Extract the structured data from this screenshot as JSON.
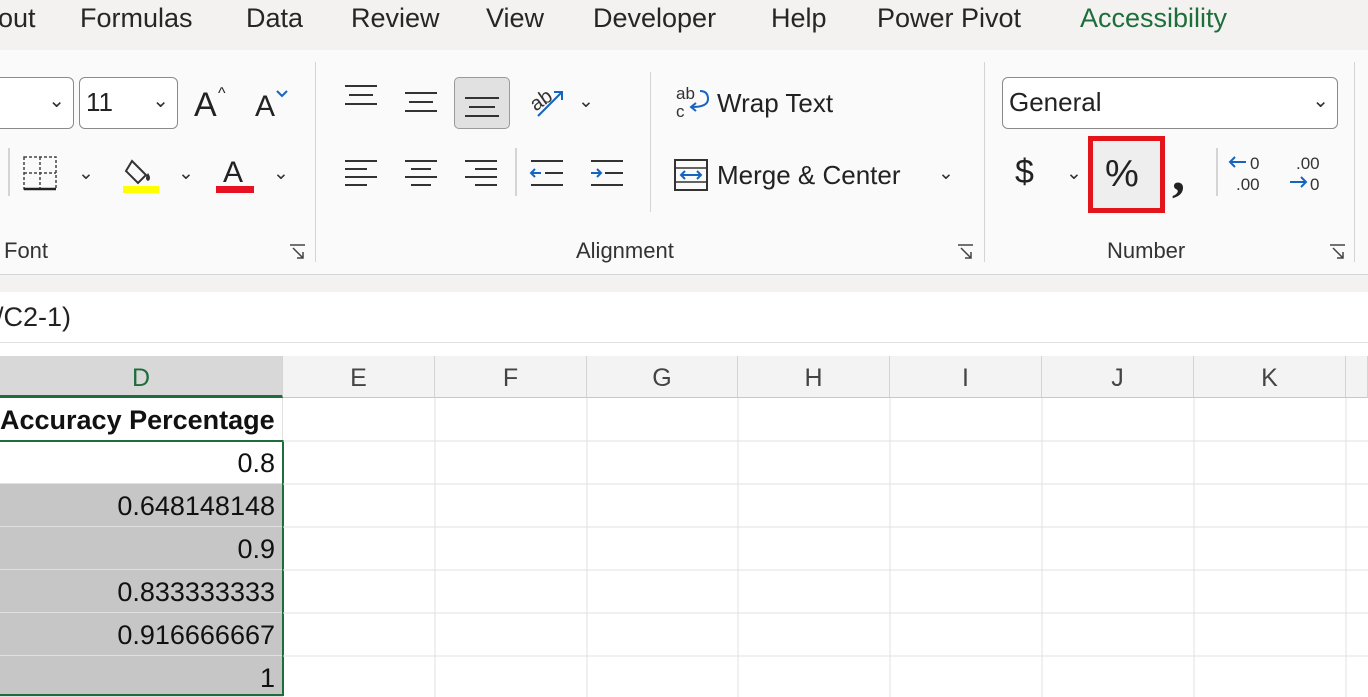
{
  "tabs": [
    "out",
    "Formulas",
    "Data",
    "Review",
    "View",
    "Developer",
    "Help",
    "Power Pivot",
    "Accessibility"
  ],
  "font_group": {
    "label": "Font",
    "font_size": "11"
  },
  "alignment_group": {
    "label": "Alignment",
    "wrap_text": "Wrap Text",
    "merge_center": "Merge & Center"
  },
  "number_group": {
    "label": "Number",
    "format": "General",
    "currency_symbol": "$",
    "percent_symbol": "%",
    "comma_symbol": ","
  },
  "formula_bar": {
    "text": "/C2-1)"
  },
  "columns": [
    "D",
    "E",
    "F",
    "G",
    "H",
    "I",
    "J",
    "K"
  ],
  "column_d": {
    "header": "Accuracy Percentage",
    "values": [
      "0.8",
      "0.648148148",
      "0.9",
      "0.833333333",
      "0.916666667",
      "1"
    ]
  },
  "colors": {
    "accent_green": "#1e6e3c",
    "highlight_box": "#e4141b",
    "fill_yellow": "#ffff00",
    "font_red": "#e81123"
  },
  "icons": [
    "increase-font-size-icon",
    "decrease-font-size-icon",
    "borders-icon",
    "fill-color-icon",
    "font-color-icon",
    "align-top-icon",
    "align-middle-icon",
    "align-bottom-icon",
    "orientation-icon",
    "align-left-icon",
    "align-center-icon",
    "align-right-icon",
    "decrease-indent-icon",
    "increase-indent-icon",
    "wrap-text-icon",
    "merge-center-icon",
    "currency-icon",
    "percent-icon",
    "comma-style-icon",
    "increase-decimal-icon",
    "decrease-decimal-icon",
    "dialog-launcher-icon"
  ]
}
